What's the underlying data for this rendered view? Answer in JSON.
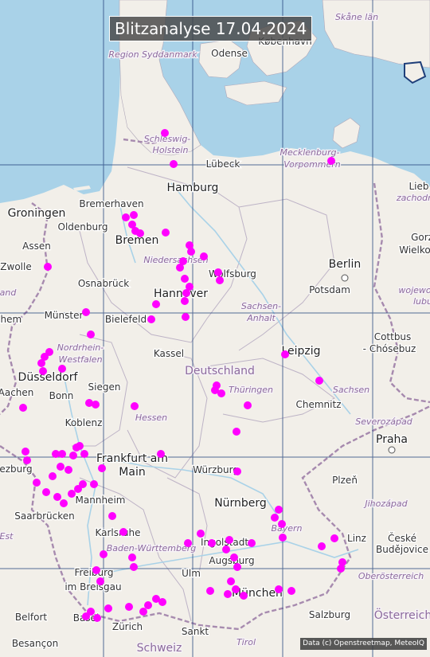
{
  "title": "Blitzanalyse 17.04.2024",
  "attribution": "Data (c) Openstreetmap, MeteoIQ",
  "colors": {
    "sea": "#a9d2e8",
    "land": "#f2efe9",
    "lightning": "#ff00ff",
    "border": "#9e7fa8",
    "grid": "#1f3f7a"
  },
  "labels": [
    {
      "text": "Skåne län",
      "kind": "region"
    },
    {
      "text": "København",
      "kind": "city"
    },
    {
      "text": "Region Syddanmark",
      "kind": "region"
    },
    {
      "text": "Odense",
      "kind": "city"
    },
    {
      "text": "Schleswig-",
      "kind": "region"
    },
    {
      "text": "Holstein",
      "kind": "region"
    },
    {
      "text": "Mecklenburg-",
      "kind": "region"
    },
    {
      "text": "Vorpommern",
      "kind": "region"
    },
    {
      "text": "Lübeck",
      "kind": "city"
    },
    {
      "text": "Hamburg",
      "kind": "city-major"
    },
    {
      "text": "Bremerhaven",
      "kind": "city"
    },
    {
      "text": "Groningen",
      "kind": "city-major"
    },
    {
      "text": "Oldenburg",
      "kind": "city"
    },
    {
      "text": "Bremen",
      "kind": "city-major"
    },
    {
      "text": "Assen",
      "kind": "city"
    },
    {
      "text": "Zwolle",
      "kind": "city"
    },
    {
      "text": "Niedersachsen",
      "kind": "region"
    },
    {
      "text": "Berlin",
      "kind": "city-major"
    },
    {
      "text": "Wolfsburg",
      "kind": "city"
    },
    {
      "text": "Osnabrück",
      "kind": "city"
    },
    {
      "text": "Hannover",
      "kind": "city-major"
    },
    {
      "text": "Potsdam",
      "kind": "city"
    },
    {
      "text": "Münster",
      "kind": "city"
    },
    {
      "text": "Bielefeld",
      "kind": "city"
    },
    {
      "text": "Sachsen-",
      "kind": "region"
    },
    {
      "text": "Anhalt",
      "kind": "region"
    },
    {
      "text": "Nordrhein-",
      "kind": "region"
    },
    {
      "text": "Westfalen",
      "kind": "region"
    },
    {
      "text": "Kassel",
      "kind": "city"
    },
    {
      "text": "Leipzig",
      "kind": "city-major"
    },
    {
      "text": "Cottbus",
      "kind": "city"
    },
    {
      "text": "- Chósebuz",
      "kind": "city"
    },
    {
      "text": "Düsseldorf",
      "kind": "city-major"
    },
    {
      "text": "Deutschland",
      "kind": "country"
    },
    {
      "text": "Thüringen",
      "kind": "region"
    },
    {
      "text": "Sachsen",
      "kind": "region"
    },
    {
      "text": "Aachen",
      "kind": "city"
    },
    {
      "text": "Bonn",
      "kind": "city"
    },
    {
      "text": "Siegen",
      "kind": "city"
    },
    {
      "text": "Chemnitz",
      "kind": "city"
    },
    {
      "text": "Hessen",
      "kind": "region"
    },
    {
      "text": "Koblenz",
      "kind": "city"
    },
    {
      "text": "Severozápad",
      "kind": "region"
    },
    {
      "text": "Praha",
      "kind": "city-major"
    },
    {
      "text": "Frankfurt am",
      "kind": "city-major"
    },
    {
      "text": "Main",
      "kind": "city-major"
    },
    {
      "text": "Würzburg",
      "kind": "city"
    },
    {
      "text": "Plzeň",
      "kind": "city"
    },
    {
      "text": "Mannheim",
      "kind": "city"
    },
    {
      "text": "Nürnberg",
      "kind": "city-major"
    },
    {
      "text": "Jihozápad",
      "kind": "region"
    },
    {
      "text": "Saarbrücken",
      "kind": "city"
    },
    {
      "text": "Karlsruhe",
      "kind": "city"
    },
    {
      "text": "Bayern",
      "kind": "region"
    },
    {
      "text": "Ingolstadt",
      "kind": "city"
    },
    {
      "text": "České",
      "kind": "city"
    },
    {
      "text": "Budějovice",
      "kind": "city"
    },
    {
      "text": "Baden-Württemberg",
      "kind": "region"
    },
    {
      "text": "Augsburg",
      "kind": "city"
    },
    {
      "text": "Ulm",
      "kind": "city"
    },
    {
      "text": "Freiburg",
      "kind": "city"
    },
    {
      "text": "im Breisgau",
      "kind": "city"
    },
    {
      "text": "Oberösterreich",
      "kind": "region"
    },
    {
      "text": "München",
      "kind": "city-major"
    },
    {
      "text": "Salzburg",
      "kind": "city"
    },
    {
      "text": "Österreich",
      "kind": "country"
    },
    {
      "text": "Belfort",
      "kind": "city"
    },
    {
      "text": "Basel",
      "kind": "city"
    },
    {
      "text": "Zürich",
      "kind": "city"
    },
    {
      "text": "Sankt",
      "kind": "city"
    },
    {
      "text": "Tirol",
      "kind": "region"
    },
    {
      "text": "Besançon",
      "kind": "city"
    },
    {
      "text": "Gorz",
      "kind": "city"
    },
    {
      "text": "Wielko",
      "kind": "city"
    },
    {
      "text": "zachodn",
      "kind": "region"
    },
    {
      "text": "wojewo",
      "kind": "region"
    },
    {
      "text": "lubu",
      "kind": "region"
    },
    {
      "text": "Lieb",
      "kind": "city"
    },
    {
      "text": "Linz",
      "kind": "city"
    },
    {
      "text": "and",
      "kind": "region"
    },
    {
      "text": "nhem",
      "kind": "city"
    },
    {
      "text": "ezburg",
      "kind": "city"
    },
    {
      "text": "Est",
      "kind": "region"
    },
    {
      "text": "Schweiz",
      "kind": "country"
    }
  ]
}
